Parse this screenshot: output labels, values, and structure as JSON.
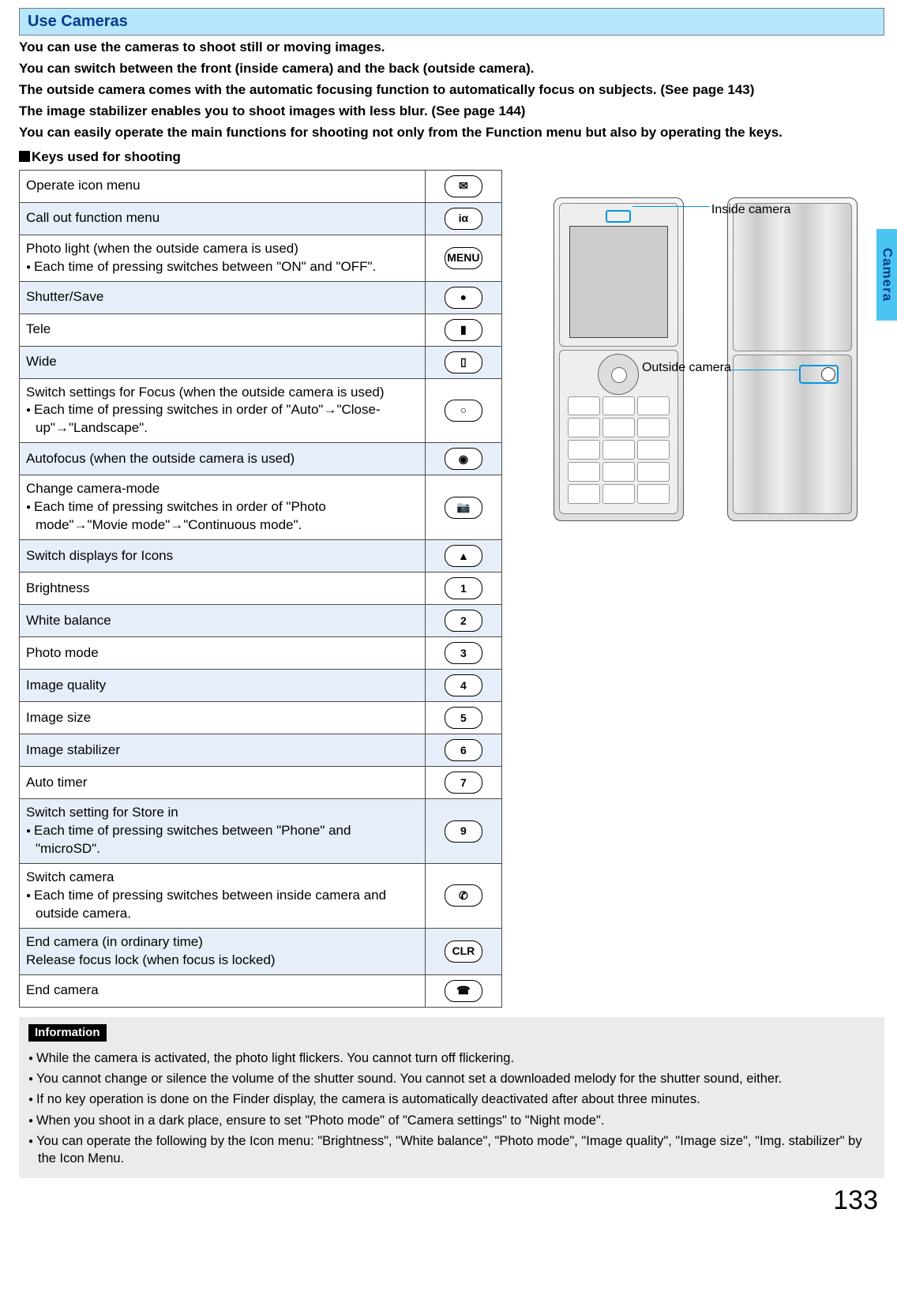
{
  "title": "Use Cameras",
  "intro": [
    "You can use the cameras to shoot still or moving images.",
    "You can switch between the front (inside camera) and the back (outside camera).",
    "The outside camera comes with the automatic focusing function to automatically focus on subjects. (See page 143)",
    "The image stabilizer enables you to shoot images with less blur. (See page 144)",
    "You can easily operate the main functions for shooting not only from the Function menu but also by operating the keys."
  ],
  "keys_heading": "Keys used for shooting",
  "table": [
    {
      "lines": [
        "Operate icon menu"
      ],
      "bullets": [],
      "key": "✉"
    },
    {
      "lines": [
        "Call out function menu"
      ],
      "bullets": [],
      "key": "iα"
    },
    {
      "lines": [
        "Photo light (when the outside camera is used)"
      ],
      "bullets": [
        "Each time of pressing switches between \"ON\" and \"OFF\"."
      ],
      "key": "MENU"
    },
    {
      "lines": [
        "Shutter/Save"
      ],
      "bullets": [],
      "key": "●"
    },
    {
      "lines": [
        "Tele"
      ],
      "bullets": [],
      "key": "▮"
    },
    {
      "lines": [
        "Wide"
      ],
      "bullets": [],
      "key": "▯"
    },
    {
      "lines": [
        "Switch settings for Focus (when the outside camera is used)"
      ],
      "bullets": [
        "Each time of pressing switches in order of \"Auto\"→\"Close-up\"→\"Landscape\"."
      ],
      "key": "○"
    },
    {
      "lines": [
        "Autofocus (when the outside camera is used)"
      ],
      "bullets": [],
      "key": "◉"
    },
    {
      "lines": [
        "Change camera-mode"
      ],
      "bullets": [
        "Each time of pressing switches in order of \"Photo mode\"→\"Movie mode\"→\"Continuous mode\"."
      ],
      "key": "📷"
    },
    {
      "lines": [
        "Switch displays for Icons"
      ],
      "bullets": [],
      "key": "▲"
    },
    {
      "lines": [
        "Brightness"
      ],
      "bullets": [],
      "key": "1"
    },
    {
      "lines": [
        "White balance"
      ],
      "bullets": [],
      "key": "2"
    },
    {
      "lines": [
        "Photo mode"
      ],
      "bullets": [],
      "key": "3"
    },
    {
      "lines": [
        "Image quality"
      ],
      "bullets": [],
      "key": "4"
    },
    {
      "lines": [
        "Image size"
      ],
      "bullets": [],
      "key": "5"
    },
    {
      "lines": [
        "Image stabilizer"
      ],
      "bullets": [],
      "key": "6"
    },
    {
      "lines": [
        "Auto timer"
      ],
      "bullets": [],
      "key": "7"
    },
    {
      "lines": [
        "Switch setting for Store in"
      ],
      "bullets": [
        "Each time of pressing switches between \"Phone\" and \"microSD\"."
      ],
      "key": "9"
    },
    {
      "lines": [
        "Switch camera"
      ],
      "bullets": [
        "Each time of pressing switches between inside camera and outside camera."
      ],
      "key": "✆"
    },
    {
      "lines": [
        "End camera (in ordinary time)",
        "Release focus lock (when focus is locked)"
      ],
      "bullets": [],
      "key": "CLR"
    },
    {
      "lines": [
        "End camera"
      ],
      "bullets": [],
      "key": "☎"
    }
  ],
  "labels": {
    "inside": "Inside camera",
    "outside": "Outside camera"
  },
  "info_title": "Information",
  "info": [
    "While the camera is activated, the photo light flickers. You cannot turn off flickering.",
    "You cannot change or silence the volume of the shutter sound. You cannot set a downloaded melody for the shutter sound, either.",
    "If no key operation is done on the Finder display, the camera is automatically deactivated after about three minutes.",
    "When you shoot in a dark place, ensure to set \"Photo mode\" of \"Camera settings\" to \"Night mode\".",
    "You can operate the following by the Icon menu: \"Brightness\", \"White balance\", \"Photo mode\", \"Image quality\", \"Image size\", \"Img. stabilizer\" by the Icon Menu."
  ],
  "side_tab": "Camera",
  "page_number": "133"
}
